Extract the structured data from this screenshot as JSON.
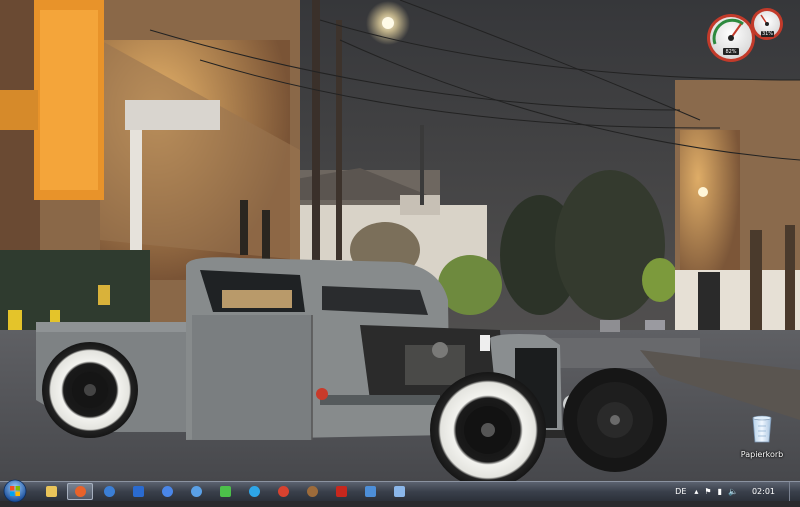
{
  "desktop": {
    "icons": [
      {
        "label": "Papierkorb",
        "icon": "recycle-bin-icon"
      }
    ]
  },
  "gadget": {
    "cpu_gauge_value": "82%",
    "memory_gauge_value": "31%"
  },
  "taskbar": {
    "start_icon": "windows-start-orb-icon",
    "apps": [
      {
        "name": "explorer",
        "icon": "folder-icon",
        "color": "#e9c45a"
      },
      {
        "name": "firefox",
        "icon": "firefox-icon",
        "color": "#e8622a",
        "active": true
      },
      {
        "name": "app-3",
        "icon": "blue-circle-icon",
        "color": "#3b7fd6"
      },
      {
        "name": "app-4",
        "icon": "blue-app-icon",
        "color": "#2a6bd1"
      },
      {
        "name": "app-5",
        "icon": "blue-sphere-icon",
        "color": "#4a86e8"
      },
      {
        "name": "app-6",
        "icon": "globe-icon",
        "color": "#5aa0e6"
      },
      {
        "name": "app-7",
        "icon": "green-gem-icon",
        "color": "#4cc04a"
      },
      {
        "name": "app-8",
        "icon": "skype-icon",
        "color": "#2ea6e8"
      },
      {
        "name": "app-9",
        "icon": "red-gear-icon",
        "color": "#d8422f"
      },
      {
        "name": "app-10",
        "icon": "wheel-icon",
        "color": "#9d6b3a"
      },
      {
        "name": "filezilla",
        "icon": "filezilla-icon",
        "color": "#c7271d"
      },
      {
        "name": "app-12",
        "icon": "monitor-icon",
        "color": "#4d8fd9"
      },
      {
        "name": "app-13",
        "icon": "window-icon",
        "color": "#8bb7ea"
      }
    ],
    "tray": {
      "language": "DE",
      "time": "02:01"
    }
  },
  "colors": {
    "taskbar": "#3a404b",
    "sky": "#48494c"
  }
}
